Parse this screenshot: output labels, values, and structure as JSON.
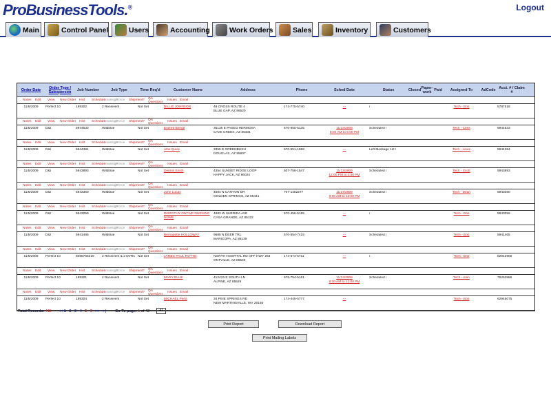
{
  "header": {
    "logo": "ProBusinessTools.",
    "logout": "Logout"
  },
  "nav": {
    "tabs": [
      {
        "label": "Main",
        "icon": "globe-icon"
      },
      {
        "label": "Control Panel",
        "icon": "wrench-icon"
      },
      {
        "label": "Users",
        "icon": "users-icon"
      },
      {
        "label": "Accounting",
        "icon": "accountant-icon"
      },
      {
        "label": "Work Orders",
        "icon": "truck-icon"
      },
      {
        "label": "Sales",
        "icon": "handshake-icon"
      },
      {
        "label": "Inventory",
        "icon": "box-icon"
      },
      {
        "label": "Customers",
        "icon": "customers-icon"
      }
    ]
  },
  "grid": {
    "columns": [
      "Order Date",
      "Order Type / Salesperson",
      "Job Number",
      "Job Type",
      "Time Req'd",
      "Customer Name",
      "Address",
      "Phone",
      "Sched Date",
      "Status",
      "Closed",
      "Paper-work",
      "Paid",
      "Assigned To",
      "AdCode",
      "Acct. # / Claim #"
    ],
    "actions": [
      "Notes",
      "Edit",
      "View",
      "New Order",
      "Hist",
      "Schedule",
      "Unassign",
      "Force",
      "Shipment?",
      "QA Questions",
      "Issues",
      "Email"
    ],
    "rows": [
      {
        "date": "11/5/2009",
        "type": "Perfect 10",
        "job": "189302",
        "jobtype": "2 Receivers",
        "time": "Not Set",
        "name": "BILLIE JOHNSON",
        "addr1": "48 CROSS ROUTE 4",
        "addr2": "BLUE GAP, AZ 86520",
        "phone": "174-775-5740",
        "sched1": "---",
        "sched2": "",
        "status": "/",
        "assigned": "Tech - Bob",
        "acct": "5787518"
      },
      {
        "date": "11/5/2009",
        "type": "D&I",
        "job": "5944533",
        "jobtype": "Wildblue",
        "time": "Not Set",
        "name": "Everett Bengtt",
        "addr1": "35135 E PASEO HERMOSA",
        "addr2": "CAVE CREEK, AZ 85331",
        "phone": "570-550-5135",
        "sched1": "11/13/2009",
        "sched2": "8:00 AM to 9:00 PM",
        "status": "Scheduled /",
        "assigned": "Tech - Chris",
        "acct": "5944533"
      },
      {
        "date": "11/5/2009",
        "type": "D&I",
        "job": "5944384",
        "jobtype": "Wildblue",
        "time": "Not Set",
        "name": "Alfie Quick",
        "addr1": "3355 E GREENBUSH",
        "addr2": "DOUGLAS, AZ 85607",
        "phone": "570-551-1658",
        "sched1": "---",
        "sched2": "",
        "status": "Left Message 1st /",
        "assigned": "Tech - Linus",
        "acct": "5944384"
      },
      {
        "date": "11/5/2009",
        "type": "D&I",
        "job": "5943893",
        "jobtype": "Wildblue",
        "time": "Not Set",
        "name": "Dennis Smith",
        "addr1": "4354 SUNSET RIDGE LOOP",
        "addr2": "HAPPY JACK, AZ 86024",
        "phone": "507-758-1547",
        "sched1": "11/13/2009",
        "sched2": "12:00 PM to 4:00 PM",
        "status": "Scheduled /",
        "assigned": "Tech - Scott",
        "acct": "5943893"
      },
      {
        "date": "11/5/2009",
        "type": "D&I",
        "job": "5943360",
        "jobtype": "Wildblue",
        "time": "Not Set",
        "name": "John Lucas",
        "addr1": "4584 N CANYON DR",
        "addr2": "GOLDEN SPRINGS, AZ 85441",
        "phone": "707-1452277",
        "sched1": "11/17/2009",
        "sched2": "8:00 AM to 12:00 PM",
        "status": "Scheduled /",
        "assigned": "Tech - Dean",
        "acct": "5943360"
      },
      {
        "date": "11/5/2009",
        "type": "D&I",
        "job": "5943059",
        "jobtype": "Wildblue",
        "time": "Not Set",
        "name": "DOROTHY ONTIVE NURSING HOME",
        "addr1": "4883 W SHERIDA AVE",
        "addr2": "CASA GRANDE, AZ 85122",
        "phone": "570-456-5155",
        "sched1": "---",
        "sched2": "",
        "status": "/",
        "assigned": "Tech - Bob",
        "acct": "5943059"
      },
      {
        "date": "11/5/2009",
        "type": "D&I",
        "job": "5941465",
        "jobtype": "Wildblue",
        "time": "Not Set",
        "name": "Bernadette HOLLOWAY",
        "addr1": "9685 N DEER TRL",
        "addr2": "MARICOPA, AZ 85139",
        "phone": "570-554-7415",
        "sched1": "---",
        "sched2": "",
        "status": "Scheduled /",
        "assigned": "Tech - Bob",
        "acct": "5941465"
      },
      {
        "date": "11/5/2009",
        "type": "Perfect 10",
        "job": "5088765319",
        "jobtype": "2 Receivers & 2 DVRs",
        "time": "Not Set",
        "name": "JAMES PAUL ROTTO",
        "addr1": "NORTH HOSPITAL RD OFF HWY 264",
        "addr2": "ONTVILLE, AZ 86530",
        "phone": "174-574-5711",
        "sched1": "---",
        "sched2": "",
        "status": "/",
        "assigned": "Tech - Bob",
        "acct": "82942900"
      },
      {
        "date": "11/5/2009",
        "type": "Perfect 10",
        "job": "189301",
        "jobtype": "4 Receivers",
        "time": "Not Set",
        "name": "MARY BLUE",
        "addr1": "412415 E SOUTH LN",
        "addr2": "ALPINE, AZ 85526",
        "phone": "575-754-5161",
        "sched1": "11/13/2009",
        "sched2": "8:00 AM to 12:00 PM",
        "status": "Scheduled /",
        "assigned": "Tech - Alan",
        "acct": "76263886"
      },
      {
        "date": "11/5/2009",
        "type": "Perfect 10",
        "job": "189304",
        "jobtype": "2 Receivers",
        "time": "Not Set",
        "name": "MICHAEL Perla",
        "addr1": "34 PINE SPRINGS RD",
        "addr2": "NEW MARTINSVILLE, WV 26155",
        "phone": "174-445-5777",
        "sched1": "---",
        "sched2": "",
        "status": "",
        "assigned": "Tech - Bob",
        "acct": "62945075"
      }
    ]
  },
  "footer": {
    "total_label": "Total Records:",
    "total_value": "415",
    "pages": [
      "<< 1",
      "2",
      "3",
      "4",
      "5",
      "6",
      ">>",
      ">|"
    ],
    "goto_label": "Go To page:",
    "goto_value": "1",
    "page_of": "of 42",
    "page_input": "41"
  },
  "buttons": {
    "print_report": "Print Report",
    "download_report": "Download Report",
    "print_labels": "Print Mailing Labels"
  }
}
